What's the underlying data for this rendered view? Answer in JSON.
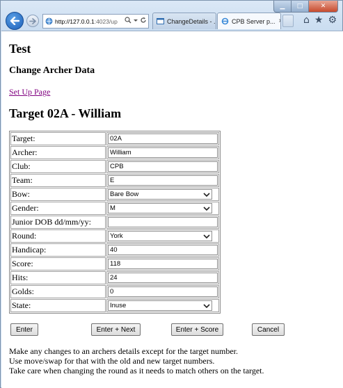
{
  "browser": {
    "address_host": "http://127.0.0.1",
    "address_rest": ":4023/up",
    "tabs": [
      {
        "label": "ChangeDetails - ..."
      },
      {
        "label": "CPB Server p...",
        "close": "×"
      }
    ]
  },
  "page": {
    "heading": "Test",
    "subheading": "Change Archer Data",
    "setup_link": "Set Up Page",
    "target_heading": "Target 02A - William"
  },
  "form": {
    "rows": [
      {
        "label": "Target:",
        "value": "02A",
        "kind": "text"
      },
      {
        "label": "Archer:",
        "value": "William",
        "kind": "text"
      },
      {
        "label": "Club:",
        "value": "CPB",
        "kind": "text"
      },
      {
        "label": "Team:",
        "value": "E",
        "kind": "text"
      },
      {
        "label": "Bow:",
        "value": "Bare Bow",
        "kind": "select"
      },
      {
        "label": "Gender:",
        "value": "M",
        "kind": "select"
      },
      {
        "label": "Junior DOB dd/mm/yy:",
        "value": "",
        "kind": "text"
      },
      {
        "label": "Round:",
        "value": "York",
        "kind": "select"
      },
      {
        "label": "Handicap:",
        "value": "40",
        "kind": "text"
      },
      {
        "label": "Score:",
        "value": "118",
        "kind": "text"
      },
      {
        "label": "Hits:",
        "value": "24",
        "kind": "text"
      },
      {
        "label": "Golds:",
        "value": "0",
        "kind": "text"
      },
      {
        "label": "State:",
        "value": "Inuse",
        "kind": "select"
      }
    ]
  },
  "buttons": {
    "enter": "Enter",
    "enter_next": "Enter + Next",
    "enter_score": "Enter + Score",
    "cancel": "Cancel"
  },
  "notes": [
    "Make any changes to an archers details except for the target number.",
    "Use move/swap for that with the old and new target numbers.",
    "Take care when changing the round as it needs to match others on the target."
  ]
}
